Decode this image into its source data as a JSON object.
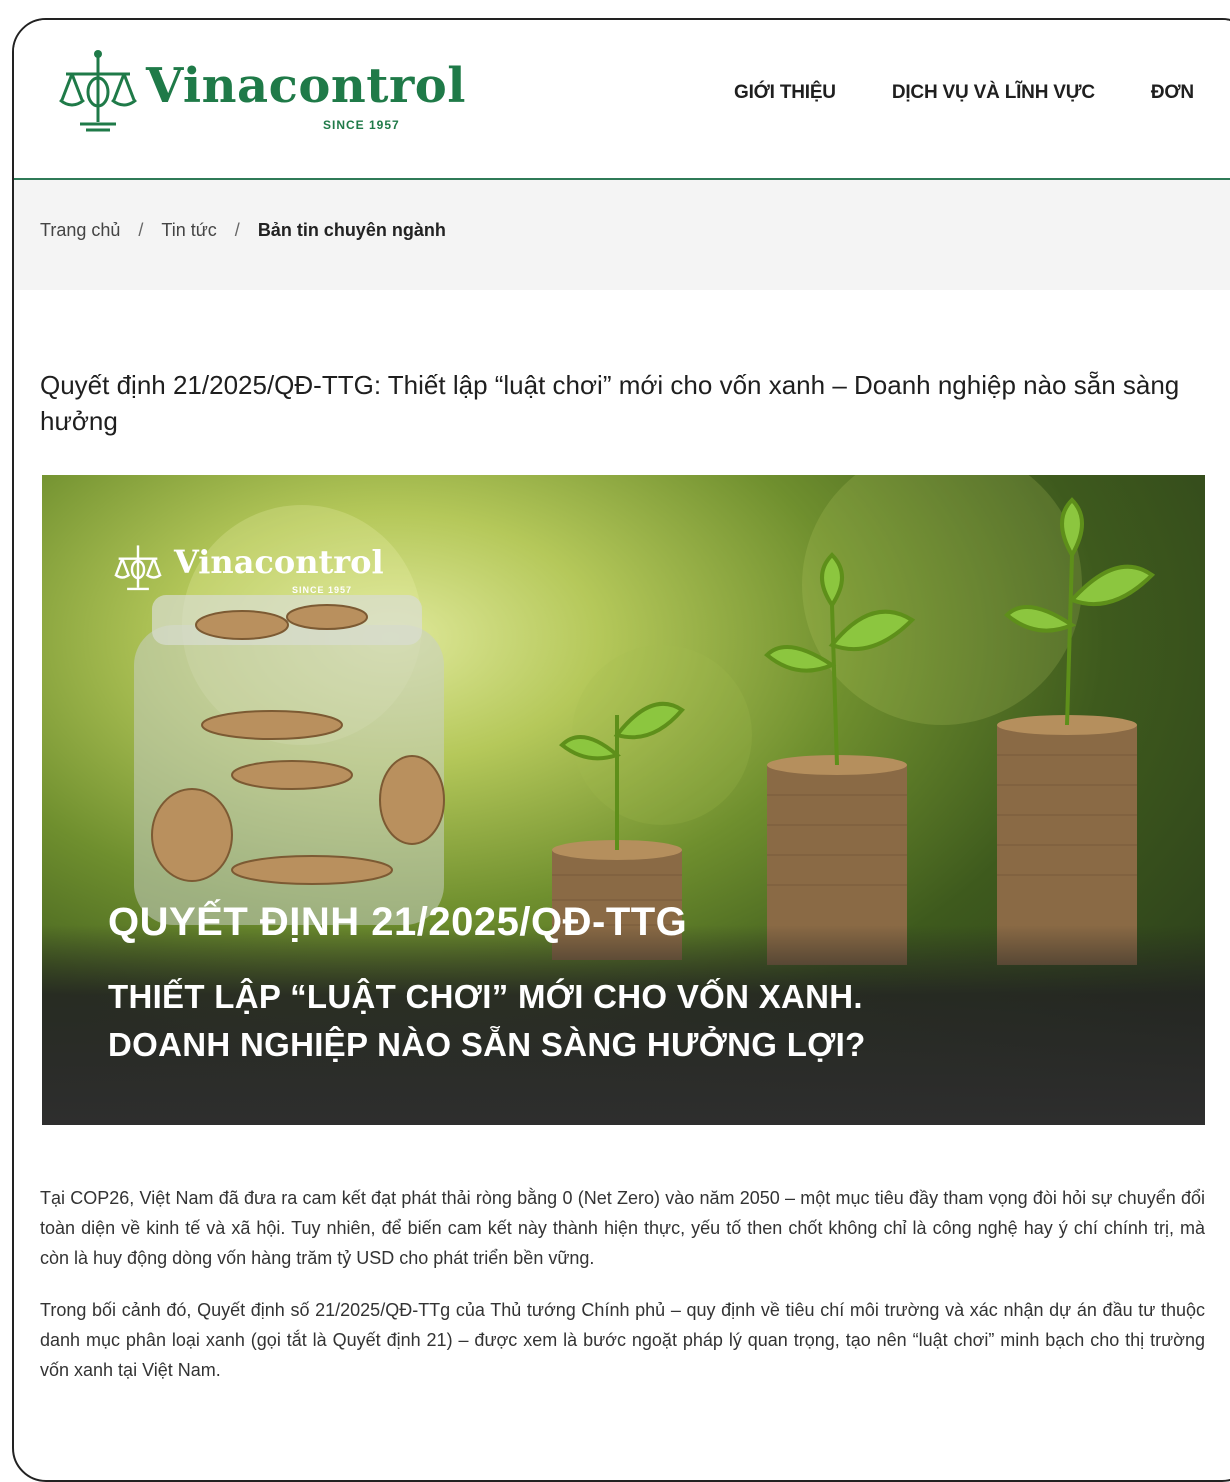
{
  "header": {
    "logo_text": "Vinacontrol",
    "logo_since": "SINCE 1957",
    "nav": [
      "GIỚI THIỆU",
      "DỊCH VỤ VÀ LĨNH VỰC",
      "ĐƠN"
    ]
  },
  "breadcrumb": [
    "Trang chủ",
    "Tin tức",
    "Bản tin chuyên ngành"
  ],
  "article": {
    "title": "Quyết định 21/2025/QĐ-TTG: Thiết lập “luật chơi” mới cho vốn xanh – Doanh nghiệp nào sẵn sàng hưởng",
    "hero": {
      "logo_text": "Vinacontrol",
      "logo_since": "SINCE 1957",
      "heading": "QUYẾT ĐỊNH 21/2025/QĐ-TTG",
      "subheading_line1": "THIẾT LẬP “LUẬT CHƠI” MỚI CHO VỐN XANH.",
      "subheading_line2": "DOANH NGHIỆP NÀO SẴN SÀNG HƯỞNG LỢI?"
    },
    "paragraphs": [
      "Tại COP26, Việt Nam đã đưa ra cam kết đạt phát thải ròng bằng 0 (Net Zero) vào năm 2050 – một mục tiêu đầy tham vọng đòi hỏi sự chuyển đổi toàn diện về kinh tế và xã hội. Tuy nhiên, để biến cam kết này thành hiện thực, yếu tố then chốt không chỉ là công nghệ hay ý chí chính trị, mà còn là huy động dòng vốn hàng trăm tỷ USD cho phát triển bền vững.",
      "Trong bối cảnh đó, Quyết định số 21/2025/QĐ-TTg của Thủ tướng Chính phủ – quy định về tiêu chí môi trường và xác nhận dự án đầu tư thuộc danh mục phân loại xanh (gọi tắt là Quyết định 21) – được xem là bước ngoặt pháp lý quan trọng, tạo nên “luật chơi” minh bạch cho thị trường vốn xanh tại Việt Nam."
    ]
  },
  "colors": {
    "brand": "#1f7a48",
    "divider": "#2f7a57",
    "breadcrumb_bg": "#f4f4f4"
  }
}
